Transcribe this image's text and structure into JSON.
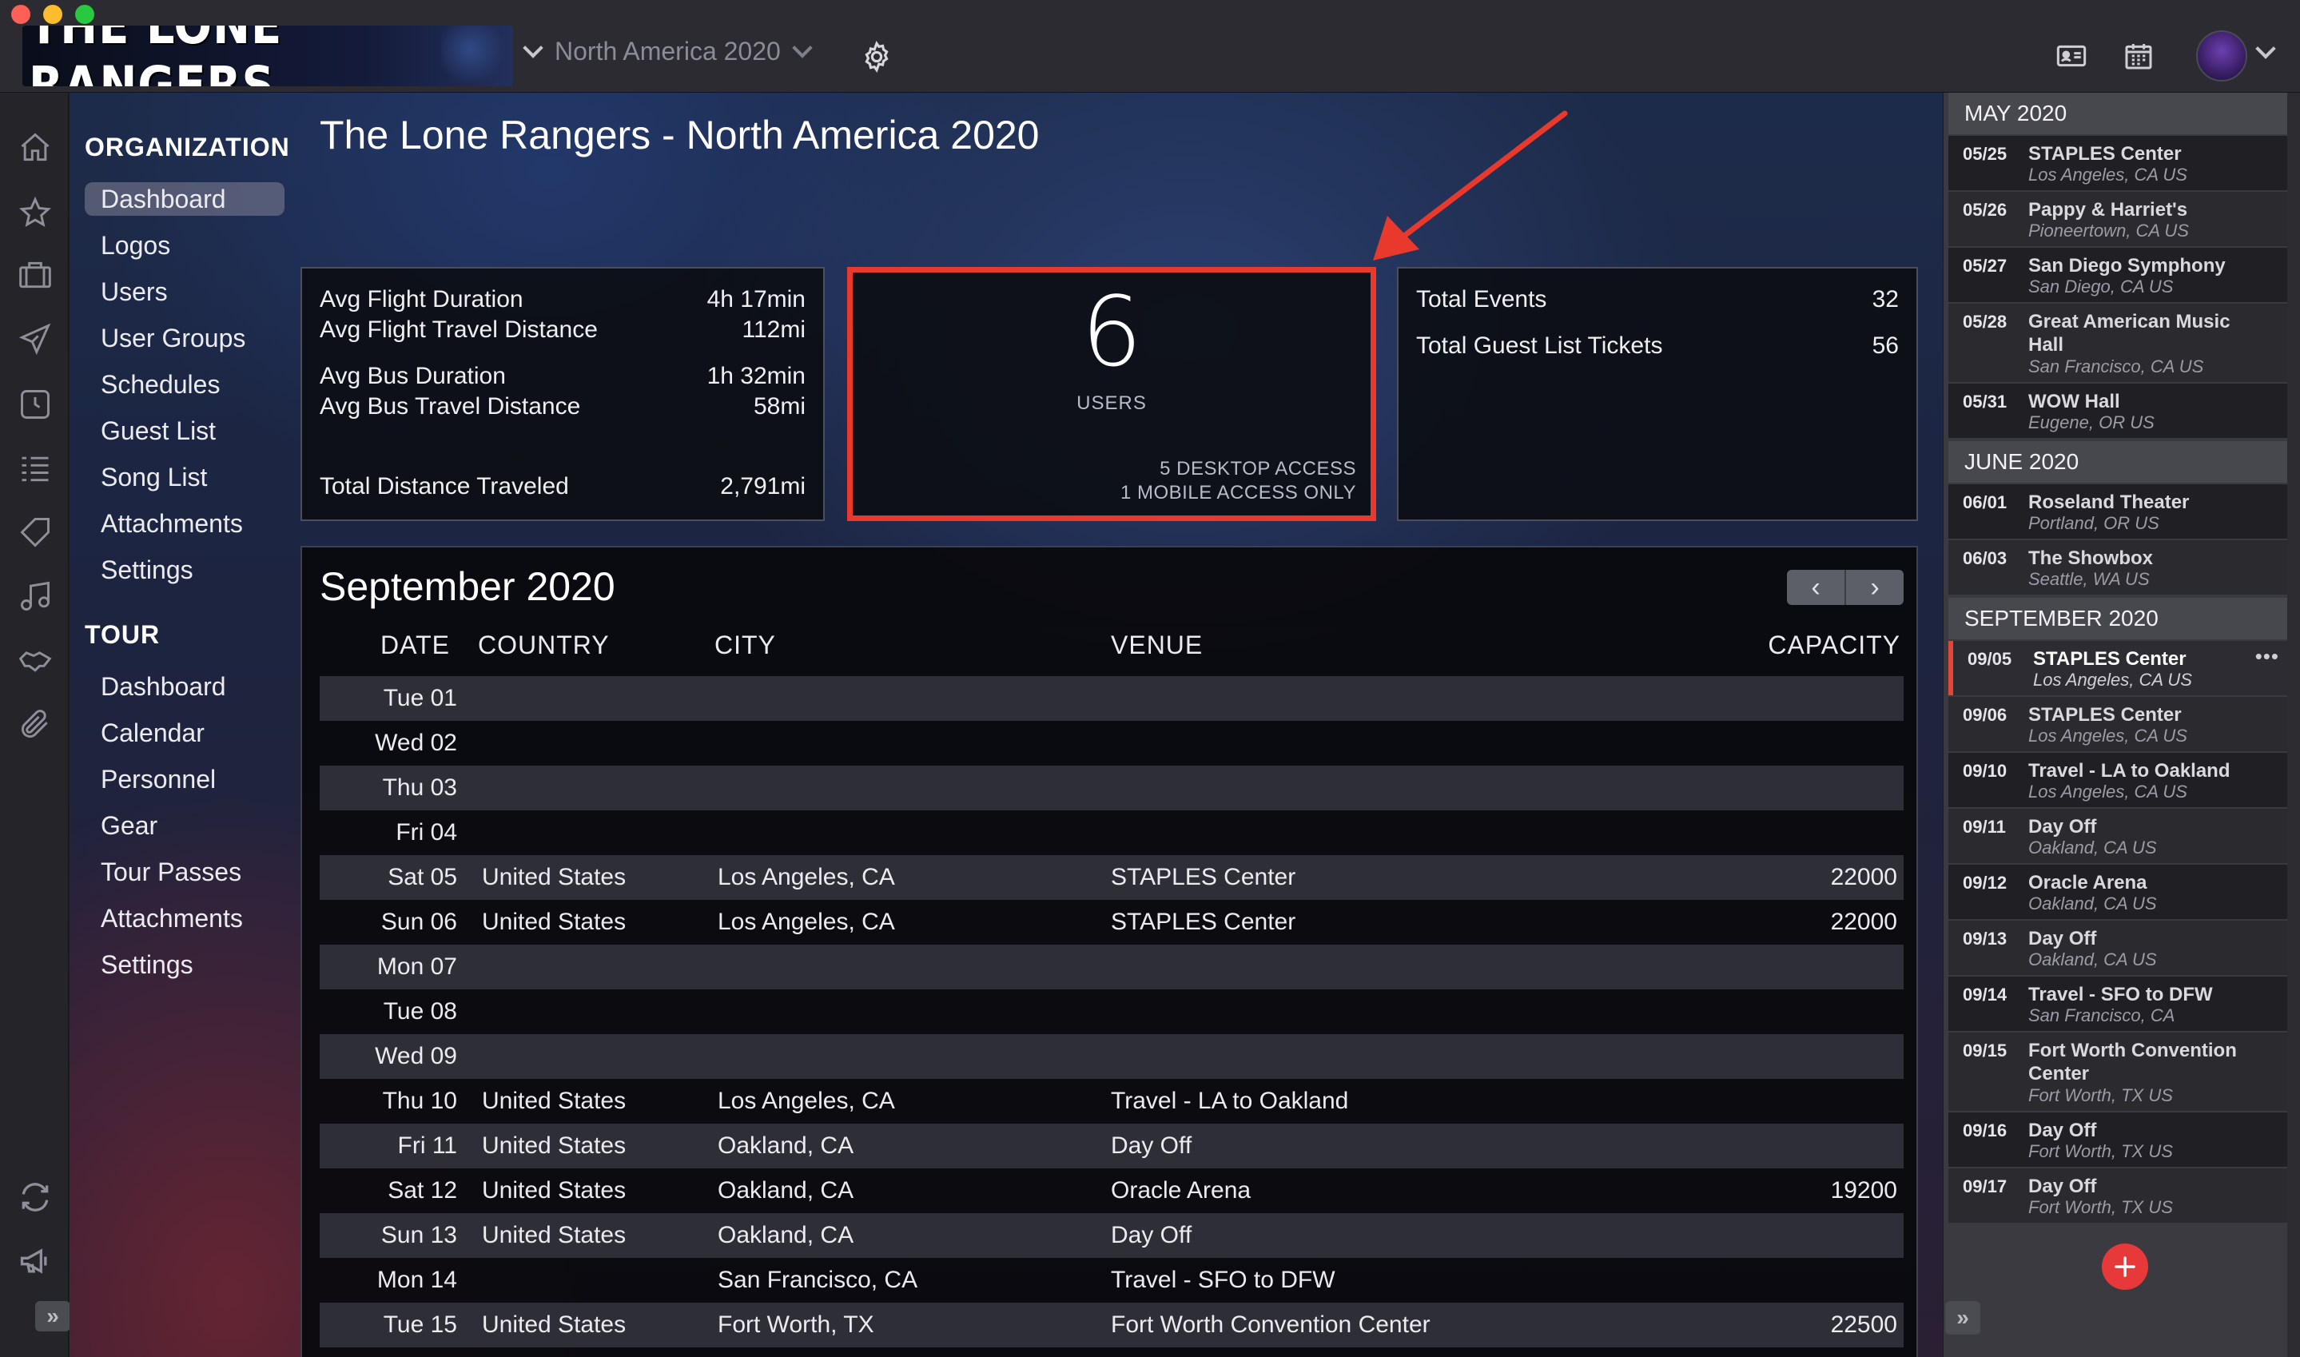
{
  "app": {
    "logo_text": "THE LONE RANGERS",
    "tour_selector": "North America 2020"
  },
  "nav": {
    "organization_heading": "ORGANIZATION",
    "organization_items": [
      "Dashboard",
      "Logos",
      "Users",
      "User Groups",
      "Schedules",
      "Guest List",
      "Song List",
      "Attachments",
      "Settings"
    ],
    "tour_heading": "TOUR",
    "tour_items": [
      "Dashboard",
      "Calendar",
      "Personnel",
      "Gear",
      "Tour Passes",
      "Attachments",
      "Settings"
    ]
  },
  "page": {
    "title": "The Lone Rangers - North America 2020"
  },
  "travel_stats": {
    "avg_flight_duration_label": "Avg Flight Duration",
    "avg_flight_duration": "4h 17min",
    "avg_flight_distance_label": "Avg Flight Travel Distance",
    "avg_flight_distance": "112mi",
    "avg_bus_duration_label": "Avg Bus Duration",
    "avg_bus_duration": "1h 32min",
    "avg_bus_distance_label": "Avg Bus Travel Distance",
    "avg_bus_distance": "58mi",
    "total_distance_label": "Total Distance Traveled",
    "total_distance": "2,791mi"
  },
  "users_card": {
    "count": "6",
    "label": "USERS",
    "desktop_access": "5 DESKTOP ACCESS",
    "mobile_access": "1 MOBILE ACCESS ONLY"
  },
  "event_stats": {
    "total_events_label": "Total Events",
    "total_events": "32",
    "guest_tickets_label": "Total Guest List Tickets",
    "guest_tickets": "56"
  },
  "calendar": {
    "month_title": "September 2020",
    "prev_label": "‹",
    "next_label": "›",
    "headers": {
      "date": "DATE",
      "country": "COUNTRY",
      "city": "CITY",
      "venue": "VENUE",
      "capacity": "CAPACITY"
    },
    "rows": [
      {
        "date": "Tue 01",
        "country": "",
        "city": "",
        "venue": "",
        "capacity": ""
      },
      {
        "date": "Wed 02",
        "country": "",
        "city": "",
        "venue": "",
        "capacity": ""
      },
      {
        "date": "Thu 03",
        "country": "",
        "city": "",
        "venue": "",
        "capacity": ""
      },
      {
        "date": "Fri 04",
        "country": "",
        "city": "",
        "venue": "",
        "capacity": ""
      },
      {
        "date": "Sat 05",
        "country": "United States",
        "city": "Los Angeles, CA",
        "venue": "STAPLES Center",
        "capacity": "22000"
      },
      {
        "date": "Sun 06",
        "country": "United States",
        "city": "Los Angeles, CA",
        "venue": "STAPLES Center",
        "capacity": "22000"
      },
      {
        "date": "Mon 07",
        "country": "",
        "city": "",
        "venue": "",
        "capacity": ""
      },
      {
        "date": "Tue 08",
        "country": "",
        "city": "",
        "venue": "",
        "capacity": ""
      },
      {
        "date": "Wed 09",
        "country": "",
        "city": "",
        "venue": "",
        "capacity": ""
      },
      {
        "date": "Thu 10",
        "country": "United States",
        "city": "Los Angeles, CA",
        "venue": "Travel - LA to Oakland",
        "capacity": ""
      },
      {
        "date": "Fri 11",
        "country": "United States",
        "city": "Oakland, CA",
        "venue": "Day Off",
        "capacity": ""
      },
      {
        "date": "Sat 12",
        "country": "United States",
        "city": "Oakland, CA",
        "venue": "Oracle Arena",
        "capacity": "19200"
      },
      {
        "date": "Sun 13",
        "country": "United States",
        "city": "Oakland, CA",
        "venue": "Day Off",
        "capacity": ""
      },
      {
        "date": "Mon 14",
        "country": "",
        "city": "San Francisco, CA",
        "venue": "Travel - SFO to DFW",
        "capacity": ""
      },
      {
        "date": "Tue 15",
        "country": "United States",
        "city": "Fort Worth, TX",
        "venue": "Fort Worth Convention Center",
        "capacity": "22500"
      }
    ]
  },
  "schedule": {
    "months": [
      {
        "label": "MAY 2020",
        "events": [
          {
            "date": "05/25",
            "name": "STAPLES Center",
            "location": "Los Angeles, CA US"
          },
          {
            "date": "05/26",
            "name": "Pappy & Harriet's",
            "location": "Pioneertown, CA US"
          },
          {
            "date": "05/27",
            "name": "San Diego Symphony",
            "location": "San Diego, CA US"
          },
          {
            "date": "05/28",
            "name": "Great American Music Hall",
            "location": "San Francisco, CA US"
          },
          {
            "date": "05/31",
            "name": "WOW Hall",
            "location": "Eugene, OR US"
          }
        ]
      },
      {
        "label": "JUNE 2020",
        "events": [
          {
            "date": "06/01",
            "name": "Roseland Theater",
            "location": "Portland, OR US"
          },
          {
            "date": "06/03",
            "name": "The Showbox",
            "location": "Seattle, WA US"
          }
        ]
      },
      {
        "label": "SEPTEMBER 2020",
        "events": [
          {
            "date": "09/05",
            "name": "STAPLES Center",
            "location": "Los Angeles, CA US"
          },
          {
            "date": "09/06",
            "name": "STAPLES Center",
            "location": "Los Angeles, CA US"
          },
          {
            "date": "09/10",
            "name": "Travel - LA to Oakland",
            "location": "Los Angeles, CA US"
          },
          {
            "date": "09/11",
            "name": "Day Off",
            "location": "Oakland, CA US"
          },
          {
            "date": "09/12",
            "name": "Oracle Arena",
            "location": "Oakland, CA US"
          },
          {
            "date": "09/13",
            "name": "Day Off",
            "location": "Oakland, CA US"
          },
          {
            "date": "09/14",
            "name": "Travel - SFO to DFW",
            "location": "San Francisco, CA"
          },
          {
            "date": "09/15",
            "name": "Fort Worth Convention Center",
            "location": "Fort Worth, TX US"
          },
          {
            "date": "09/16",
            "name": "Day Off",
            "location": "Fort Worth, TX US"
          },
          {
            "date": "09/17",
            "name": "Day Off",
            "location": "Fort Worth, TX US"
          }
        ]
      }
    ],
    "more_label": "•••"
  },
  "icons": {
    "rail": [
      "home-icon",
      "star-icon",
      "briefcase-icon",
      "plane-icon",
      "clock-icon",
      "list-icon",
      "ticket-icon",
      "music-icon",
      "handshake-icon",
      "paperclip-icon",
      "sync-icon",
      "megaphone-icon"
    ],
    "titlebar": [
      "gear-icon",
      "id-card-icon",
      "calendar-icon",
      "avatar",
      "chevron-down-icon"
    ]
  },
  "colors": {
    "accent": "#e8392c",
    "add_button": "#e8393a",
    "selected_event_bar": "#e0473b"
  }
}
